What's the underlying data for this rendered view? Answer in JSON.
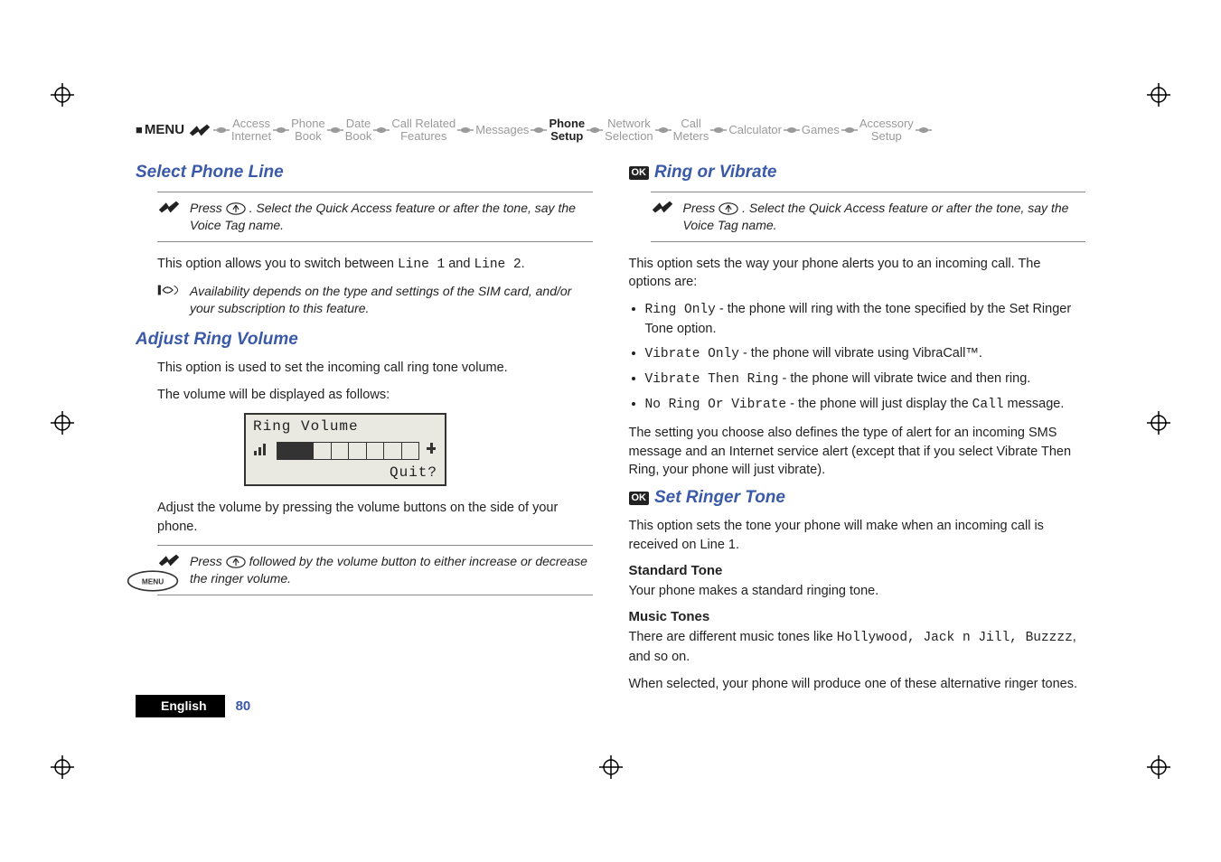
{
  "breadcrumb": {
    "menu_label": "MENU",
    "items": [
      {
        "l1": "Access",
        "l2": "Internet",
        "active": false
      },
      {
        "l1": "Phone",
        "l2": "Book",
        "active": false
      },
      {
        "l1": "Date",
        "l2": "Book",
        "active": false
      },
      {
        "l1": "Call Related",
        "l2": "Features",
        "active": false
      },
      {
        "l1": "Messages",
        "l2": "",
        "active": false
      },
      {
        "l1": "Phone",
        "l2": "Setup",
        "active": true
      },
      {
        "l1": "Network",
        "l2": "Selection",
        "active": false
      },
      {
        "l1": "Call",
        "l2": "Meters",
        "active": false
      },
      {
        "l1": "Calculator",
        "l2": "",
        "active": false
      },
      {
        "l1": "Games",
        "l2": "",
        "active": false
      },
      {
        "l1": "Accessory",
        "l2": "Setup",
        "active": false
      }
    ]
  },
  "left": {
    "h_select_line": "Select Phone Line",
    "hint_select_line_a": "Press ",
    "hint_select_line_b": ". Select the Quick Access feature or after the tone, say the Voice Tag name.",
    "p_switch_a": "This option allows you to switch between ",
    "p_switch_line1": "Line 1",
    "p_switch_and": " and ",
    "p_switch_line2": "Line 2",
    "p_switch_end": ".",
    "note_avail": "Availability depends on the type and settings of the SIM card, and/or your subscription to this feature.",
    "h_adjust": "Adjust Ring Volume",
    "p_adjust1": "This option is used to set the incoming call ring tone volume.",
    "p_adjust2": "The volume will be displayed as follows:",
    "lcd_row1": "Ring Volume",
    "lcd_row3": "Quit?",
    "p_adjust3": "Adjust the volume by pressing the volume buttons on the side of your phone.",
    "hint_vol_a": "Press ",
    "hint_vol_b": " followed by the volume button to either increase or decrease the ringer volume."
  },
  "right": {
    "h_ring": "Ring or Vibrate",
    "hint_ring_a": "Press ",
    "hint_ring_b": ". Select the Quick Access feature or after the tone, say the Voice Tag name.",
    "p_ring_intro": "This option sets the way your phone alerts you to an incoming call. The options are:",
    "li1_code": "Ring Only",
    "li1_txt": " - the phone will ring with the tone specified by the Set Ringer Tone option.",
    "li2_code": "Vibrate Only",
    "li2_txt": " - the phone will vibrate using VibraCall™.",
    "li3_code": "Vibrate Then Ring",
    "li3_txt": " - the phone will vibrate twice and then ring.",
    "li4_code": "No Ring Or Vibrate",
    "li4_txt_a": " - the phone will just display the ",
    "li4_call": "Call",
    "li4_txt_b": " message.",
    "p_ring_note": "The setting you choose also defines the type of alert for an incoming SMS message and an Internet service alert (except that if you select Vibrate Then Ring, your phone will just vibrate).",
    "h_set_tone": "Set Ringer Tone",
    "p_set_tone": "This option sets the tone your phone will make when an incoming call is received on Line 1.",
    "sub_std": "Standard Tone",
    "p_std": "Your phone makes a standard ringing tone.",
    "sub_music": "Music Tones",
    "p_music_a": "There are different music tones like ",
    "p_music_codes": "Hollywood, Jack n Jill, Buzzzz",
    "p_music_b": ", and so on.",
    "p_music2": "When selected, your phone will produce one of these alternative ringer tones."
  },
  "footer": {
    "lang": "English",
    "page": "80"
  },
  "menu_badge": "MENU"
}
